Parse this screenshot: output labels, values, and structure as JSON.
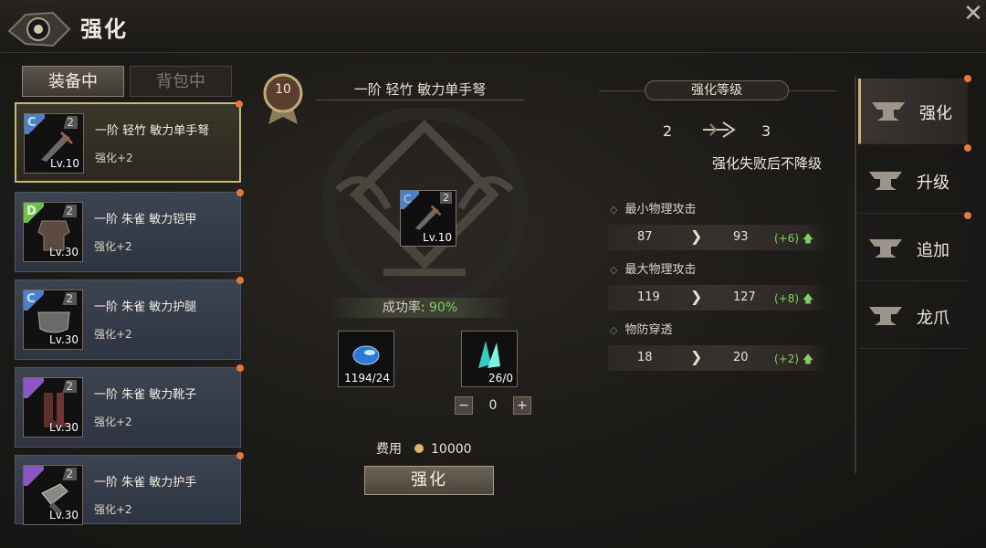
{
  "window": {
    "title": "强化"
  },
  "tabs": [
    {
      "label": "装备中",
      "active": true
    },
    {
      "label": "背包中",
      "active": false
    }
  ],
  "items": [
    {
      "grade": "C",
      "stars": "2",
      "level": "Lv.10",
      "name": "一阶 轻竹 敏力单手弩",
      "enhance": "强化+2",
      "selected": true
    },
    {
      "grade": "D",
      "stars": "2",
      "level": "Lv.30",
      "name": "一阶 朱雀 敏力铠甲",
      "enhance": "强化+2",
      "selected": false
    },
    {
      "grade": "C",
      "stars": "2",
      "level": "Lv.30",
      "name": "一阶 朱雀 敏力护腿",
      "enhance": "强化+2",
      "selected": false
    },
    {
      "grade": "",
      "stars": "2",
      "level": "Lv.30",
      "name": "一阶 朱雀 敏力靴子",
      "enhance": "强化+2",
      "selected": false
    },
    {
      "grade": "",
      "stars": "2",
      "level": "Lv.30",
      "name": "一阶 朱雀 敏力护手",
      "enhance": "强化+2",
      "selected": false
    }
  ],
  "center": {
    "badge": "10",
    "item_name": "一阶 轻竹 敏力单手弩",
    "item_grade": "C",
    "item_stars": "2",
    "item_level": "Lv.10",
    "success_label": "成功率: ",
    "success_rate": "90%",
    "materials": [
      {
        "icon": "blue-gem-icon",
        "count": "1194/24"
      },
      {
        "icon": "cyan-crystal-icon",
        "count": "26/0"
      }
    ],
    "stepper": {
      "minus": "−",
      "value": "0",
      "plus": "+"
    },
    "fee_label": "费用",
    "fee_value": "10000",
    "button": "强化"
  },
  "upgrade": {
    "title": "强化等级",
    "from": "2",
    "to": "3",
    "note": "强化失败后不降级",
    "stats": [
      {
        "label": "最小物理攻击",
        "from": "87",
        "to": "93",
        "delta": "(+6)"
      },
      {
        "label": "最大物理攻击",
        "from": "119",
        "to": "127",
        "delta": "(+8)"
      },
      {
        "label": "物防穿透",
        "from": "18",
        "to": "20",
        "delta": "(+2)"
      }
    ]
  },
  "nav": [
    {
      "label": "强化",
      "active": true,
      "dot": true
    },
    {
      "label": "升级",
      "active": false,
      "dot": true
    },
    {
      "label": "追加",
      "active": false,
      "dot": true
    },
    {
      "label": "龙爪",
      "active": false,
      "dot": false
    }
  ],
  "colors": {
    "accent": "#cbb67a",
    "positive": "#7fd05c",
    "notify": "#e9783a"
  }
}
